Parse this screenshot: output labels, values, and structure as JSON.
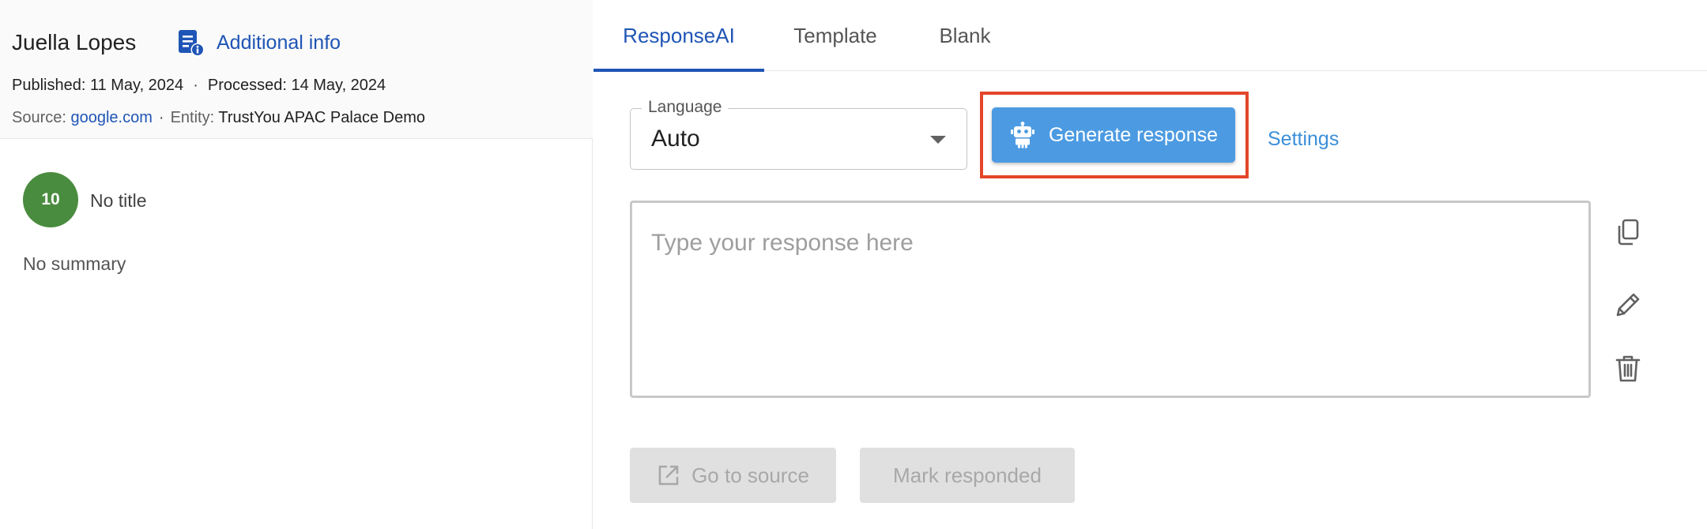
{
  "review": {
    "author": "Juella Lopes",
    "additional_info_label": "Additional info",
    "published": "Published: 11 May, 2024",
    "processed": "Processed: 14 May, 2024",
    "meta_separator": "·",
    "source_label": "Source:",
    "source_link": "google.com",
    "entity_label": "Entity:",
    "entity_value": "TrustYou APAC Palace Demo",
    "score": "10",
    "score_color": "#4a8c3f",
    "title": "No title",
    "summary": "No summary"
  },
  "tabs": [
    {
      "label": "ResponseAI",
      "active": true
    },
    {
      "label": "Template",
      "active": false
    },
    {
      "label": "Blank",
      "active": false
    }
  ],
  "composer": {
    "language_legend": "Language",
    "language_value": "Auto",
    "generate_label": "Generate response",
    "settings_label": "Settings",
    "response_placeholder": "Type your response here",
    "response_value": "",
    "go_to_source_label": "Go to source",
    "mark_responded_label": "Mark responded"
  },
  "icons": {
    "additional_info": "document-info-icon",
    "generate": "robot-icon",
    "copy": "copy-icon",
    "edit": "pencil-icon",
    "delete": "trash-icon",
    "external": "external-link-icon",
    "dropdown": "caret-down-icon"
  },
  "colors": {
    "link_blue": "#1f55b5",
    "button_blue": "#4c9be2",
    "settings_blue": "#3b8fd9",
    "highlight_red": "#e4462a",
    "disabled_bg": "#e0e0e0",
    "disabled_text": "#a8a8a8"
  }
}
